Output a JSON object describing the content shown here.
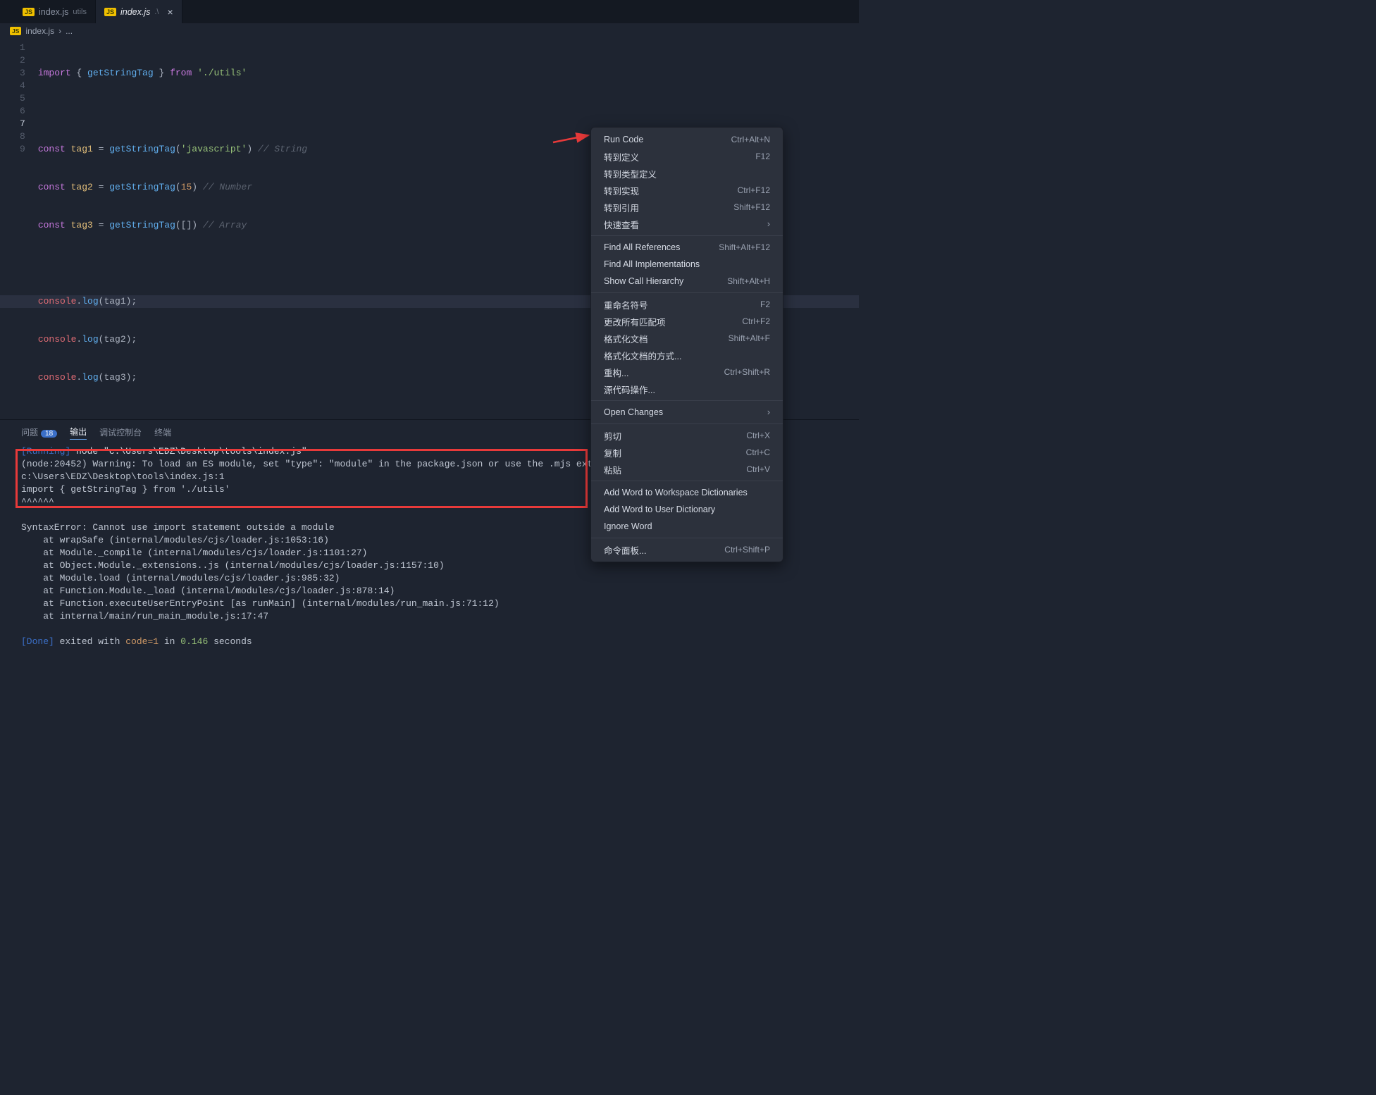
{
  "tabs": [
    {
      "badge": "JS",
      "name": "index.js",
      "sublabel": "utils"
    },
    {
      "badge": "JS",
      "name": "index.js",
      "sublabel": ".\\"
    }
  ],
  "breadcrumb": {
    "badge": "JS",
    "file": "index.js",
    "sep": "›",
    "dots": "..."
  },
  "code_lines": [
    1,
    2,
    3,
    4,
    5,
    6,
    7,
    8,
    9
  ],
  "code": {
    "l1": {
      "imp": "import",
      "br1": " { ",
      "fn": "getStringTag",
      "br2": " } ",
      "from": "from",
      "sp": " ",
      "str": "'./utils'"
    },
    "l3": {
      "kw": "const",
      "v": " tag1 ",
      "eq": "= ",
      "fn": "getStringTag",
      "p1": "(",
      "arg": "'javascript'",
      "p2": ") ",
      "com": "// String"
    },
    "l4": {
      "kw": "const",
      "v": " tag2 ",
      "eq": "= ",
      "fn": "getStringTag",
      "p1": "(",
      "arg": "15",
      "p2": ") ",
      "com": "// Number"
    },
    "l5": {
      "kw": "const",
      "v": " tag3 ",
      "eq": "= ",
      "fn": "getStringTag",
      "p1": "(",
      "arg": "[]",
      "p2": ") ",
      "com": "// Array"
    },
    "l7": {
      "obj": "console",
      "dot": ".",
      "fn": "log",
      "p1": "(",
      "arg": "tag1",
      "p2": ");"
    },
    "l8": {
      "obj": "console",
      "dot": ".",
      "fn": "log",
      "p1": "(",
      "arg": "tag2",
      "p2": ");"
    },
    "l9": {
      "obj": "console",
      "dot": ".",
      "fn": "log",
      "p1": "(",
      "arg": "tag3",
      "p2": ");"
    }
  },
  "panel": {
    "tabs": {
      "problems": "问题",
      "badge": "18",
      "output": "输出",
      "debug": "调试控制台",
      "terminal": "终端"
    }
  },
  "output": {
    "run_tag": "[Running]",
    "run_cmd": " node \"c:\\Users\\EDZ\\Desktop\\tools\\index.js\"",
    "warn": "(node:20452) Warning: To load an ES module, set \"type\": \"module\" in the package.json or use the .mjs extension.",
    "path": "c:\\Users\\EDZ\\Desktop\\tools\\index.js:1",
    "imp": "import { getStringTag } from './utils'",
    "carets": "^^^^^^",
    "blank": "",
    "err": "SyntaxError: Cannot use import statement outside a module",
    "s1": "    at wrapSafe (internal/modules/cjs/loader.js:1053:16)",
    "s2": "    at Module._compile (internal/modules/cjs/loader.js:1101:27)",
    "s3": "    at Object.Module._extensions..js (internal/modules/cjs/loader.js:1157:10)",
    "s4": "    at Module.load (internal/modules/cjs/loader.js:985:32)",
    "s5": "    at Function.Module._load (internal/modules/cjs/loader.js:878:14)",
    "s6": "    at Function.executeUserEntryPoint [as runMain] (internal/modules/run_main.js:71:12)",
    "s7": "    at internal/main/run_main_module.js:17:47",
    "done_tag": "[Done]",
    "done_a": " exited with ",
    "done_code": "code=1",
    "done_b": " in ",
    "done_sec": "0.146",
    "done_c": " seconds"
  },
  "menu": [
    {
      "label": "Run Code",
      "sc": "Ctrl+Alt+N"
    },
    {
      "label": "转到定义",
      "sc": "F12"
    },
    {
      "label": "转到类型定义",
      "sc": ""
    },
    {
      "label": "转到实现",
      "sc": "Ctrl+F12"
    },
    {
      "label": "转到引用",
      "sc": "Shift+F12"
    },
    {
      "label": "快速查看",
      "sc": "›",
      "sub": true
    },
    {
      "sep": true
    },
    {
      "label": "Find All References",
      "sc": "Shift+Alt+F12"
    },
    {
      "label": "Find All Implementations",
      "sc": ""
    },
    {
      "label": "Show Call Hierarchy",
      "sc": "Shift+Alt+H"
    },
    {
      "sep": true
    },
    {
      "label": "重命名符号",
      "sc": "F2"
    },
    {
      "label": "更改所有匹配项",
      "sc": "Ctrl+F2"
    },
    {
      "label": "格式化文档",
      "sc": "Shift+Alt+F"
    },
    {
      "label": "格式化文档的方式...",
      "sc": ""
    },
    {
      "label": "重构...",
      "sc": "Ctrl+Shift+R"
    },
    {
      "label": "源代码操作...",
      "sc": ""
    },
    {
      "sep": true
    },
    {
      "label": "Open Changes",
      "sc": "›",
      "sub": true
    },
    {
      "sep": true
    },
    {
      "label": "剪切",
      "sc": "Ctrl+X"
    },
    {
      "label": "复制",
      "sc": "Ctrl+C"
    },
    {
      "label": "粘贴",
      "sc": "Ctrl+V"
    },
    {
      "sep": true
    },
    {
      "label": "Add Word to Workspace Dictionaries",
      "sc": ""
    },
    {
      "label": "Add Word to User Dictionary",
      "sc": ""
    },
    {
      "label": "Ignore Word",
      "sc": ""
    },
    {
      "sep": true
    },
    {
      "label": "命令面板...",
      "sc": "Ctrl+Shift+P"
    }
  ]
}
